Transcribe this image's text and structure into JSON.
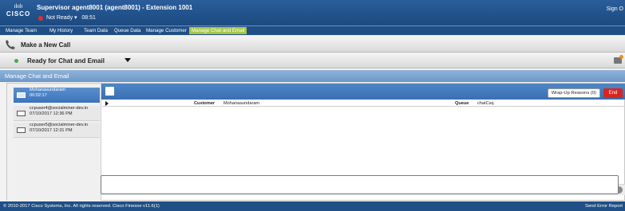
{
  "header": {
    "logo_bars": "ılıılı",
    "logo_text": "CISCO",
    "agent_title": "Supervisor agent8001 (agent8001) - Extension 1001",
    "status": "Not Ready",
    "status_caret": "▾",
    "timer": "08:51",
    "sign_out": "Sign O"
  },
  "tabs": [
    "Manage Team",
    "My History",
    "Team Data",
    "Queue Data",
    "Manage Customer",
    "Manage Chat and Email"
  ],
  "active_tab": "Manage Chat and Email",
  "call_bar": {
    "label": "Make a New Call"
  },
  "ready_bar": {
    "label": "Ready for Chat and Email"
  },
  "gadget": {
    "title": "Manage Chat and Email"
  },
  "sessions": [
    {
      "name": "Mohanasundaram",
      "detail": "00:02:17",
      "active": true
    },
    {
      "name": "ccpuser4@socialminer-dev.in",
      "detail": "07/10/2017 12:36 PM",
      "active": false
    },
    {
      "name": "ccpuser5@socialminer-dev.in",
      "detail": "07/10/2017 12:31 PM",
      "active": false
    }
  ],
  "toolbar": {
    "wrapup_label": "Wrap-Up Reasons (0)",
    "end_label": "End"
  },
  "info": {
    "customer_label": "Customer",
    "customer_value": "Mohanasundaram",
    "queue_label": "Queue",
    "queue_value": "chatCsq"
  },
  "footer": {
    "copyright": "© 2010-2017 Cisco Systems, Inc. All rights reserved. Cisco Finesse v11.6(1)",
    "send_error": "Send Error Report"
  },
  "colors": {
    "header": "#1f4f86",
    "active_tab": "#a8c548",
    "end_button": "#d8261f",
    "status_not_ready": "#e0302e",
    "status_ready": "#49a845"
  }
}
